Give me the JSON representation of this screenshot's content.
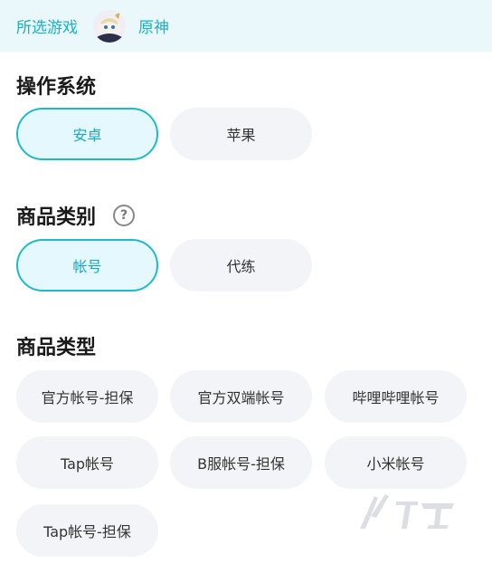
{
  "header": {
    "label": "所选游戏",
    "game_name": "原神"
  },
  "os": {
    "title": "操作系统",
    "options": [
      {
        "label": "安卓",
        "selected": true
      },
      {
        "label": "苹果",
        "selected": false
      }
    ]
  },
  "category": {
    "title": "商品类别",
    "help_icon": "question-circle-icon",
    "options": [
      {
        "label": "帐号",
        "selected": true
      },
      {
        "label": "代练",
        "selected": false
      }
    ]
  },
  "type": {
    "title": "商品类型",
    "options": [
      {
        "label": "官方帐号-担保"
      },
      {
        "label": "官方双端帐号"
      },
      {
        "label": "哔哩哔哩帐号"
      },
      {
        "label": "Tap帐号"
      },
      {
        "label": "B服帐号-担保"
      },
      {
        "label": "小米帐号"
      },
      {
        "label": "Tap帐号-担保"
      }
    ]
  },
  "colors": {
    "accent": "#20b9cc",
    "selected_bg": "#e4f8fd",
    "unselected_bg": "#f3f4f7",
    "header_bg": "#eaf8fb"
  }
}
